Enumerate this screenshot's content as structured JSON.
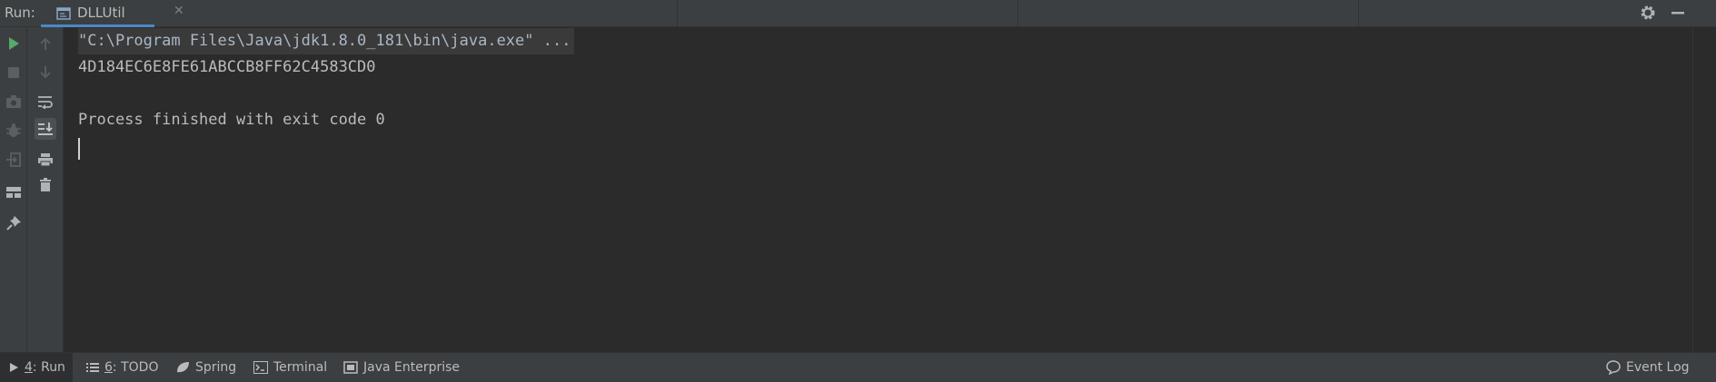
{
  "header": {
    "run_label": "Run:",
    "tab": {
      "label": "DLLUtil",
      "close_glyph": "✕"
    }
  },
  "console": {
    "command_line": "\"C:\\Program Files\\Java\\jdk1.8.0_181\\bin\\java.exe\" ...",
    "output_line": "4D184EC6E8FE61ABCCB8FF62C4583CD0",
    "exit_line": "Process finished with exit code 0"
  },
  "statusbar": {
    "tabs": [
      {
        "key": "4",
        "label": ": Run"
      },
      {
        "key": "6",
        "label": ": TODO"
      },
      {
        "key": "",
        "label": "Spring"
      },
      {
        "key": "",
        "label": "Terminal"
      },
      {
        "key": "",
        "label": "Java Enterprise"
      }
    ],
    "event_log": "Event Log"
  },
  "colors": {
    "accent": "#4a88c7",
    "run_green": "#59a869",
    "background": "#2b2b2b",
    "panel": "#3c3f41"
  },
  "icons": {
    "toolbar1": [
      "run-icon",
      "stop-icon",
      "camera-icon",
      "debug-icon",
      "exit-icon",
      "layout-icon",
      "pin-icon"
    ],
    "toolbar2": [
      "arrow-up-icon",
      "arrow-down-icon",
      "soft-wrap-icon",
      "scroll-to-end-icon",
      "print-icon",
      "trash-icon"
    ],
    "header_right": [
      "gear-icon",
      "minimize-icon"
    ]
  }
}
